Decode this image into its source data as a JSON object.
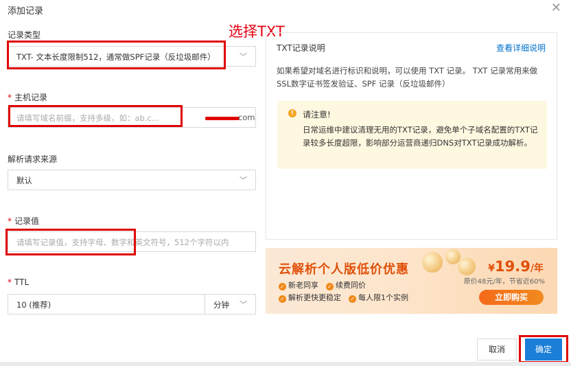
{
  "dialog": {
    "title": "添加记录",
    "close_glyph": "✕"
  },
  "annotation": {
    "text": "选择TXT"
  },
  "form": {
    "record_type": {
      "label": "记录类型",
      "value": "TXT- 文本长度限制512，通常做SPF记录（反垃圾邮件）"
    },
    "host": {
      "label": "主机记录",
      "placeholder": "请填写域名前缀，支持多级，如：ab.c...",
      "domain_suffix": "com"
    },
    "source": {
      "label": "解析请求来源",
      "value": "默认"
    },
    "record_value": {
      "label": "记录值",
      "placeholder": "请填写记录值，支持字母、数字和英文符号，512个字符以内"
    },
    "ttl": {
      "label": "TTL",
      "value": "10 (推荐)",
      "unit": "分钟"
    },
    "required_mark": "*"
  },
  "info": {
    "title": "TXT记录说明",
    "link": "查看详细说明",
    "description": "如果希望对域名进行标识和说明，可以使用 TXT 记录。 TXT 记录常用来做SSL数字证书签发验证、SPF 记录（反垃圾邮件）",
    "notice_title": "请注意!",
    "notice_body": "日常运维中建议清理无用的TXT记录，避免单个子域名配置的TXT记录较多长度超限，影响部分运营商递归DNS对TXT记录成功解析。",
    "notice_icon_glyph": "!"
  },
  "banner": {
    "title": "云解析个人版低价优惠",
    "perks": [
      "新老同享",
      "续费同价",
      "解析更快更稳定",
      "每人限1个实例"
    ],
    "price_currency": "¥",
    "price_value": "19.9",
    "price_unit": "/年",
    "original_price": "原价48元/年，节省近60%",
    "cta": "立即购买",
    "check_glyph": "✓"
  },
  "footer": {
    "cancel": "取消",
    "confirm": "确定"
  },
  "icons": {
    "caret_glyph": "﹀"
  },
  "colors": {
    "primary": "#1b7fd8",
    "annotation_red": "#e00000",
    "link": "#0070cc",
    "banner_orange": "#e0500a"
  }
}
